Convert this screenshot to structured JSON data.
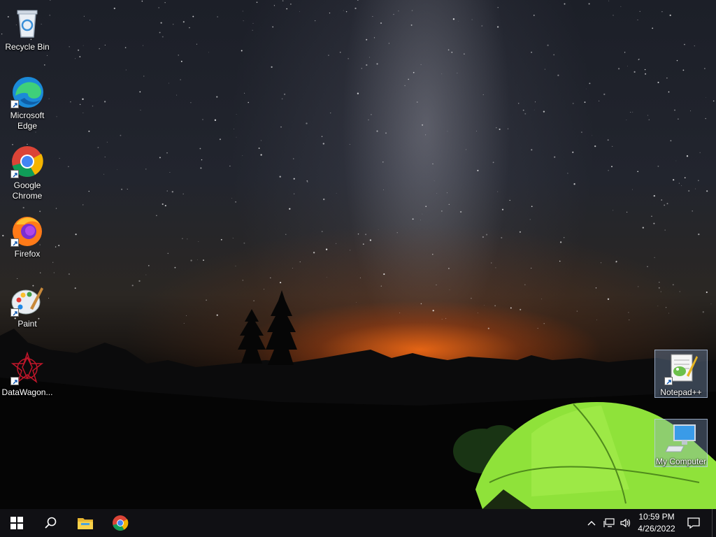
{
  "desktop": {
    "icons": [
      {
        "label": "Recycle Bin",
        "icon": "recycle-bin-icon"
      },
      {
        "label": "Microsoft Edge",
        "icon": "edge-icon"
      },
      {
        "label": "Google Chrome",
        "icon": "chrome-icon"
      },
      {
        "label": "Firefox",
        "icon": "firefox-icon"
      },
      {
        "label": "Paint",
        "icon": "paint-icon"
      },
      {
        "label": "DataWagon...",
        "icon": "datawagon-icon"
      },
      {
        "label": "Notepad++",
        "icon": "notepad-plus-plus-icon",
        "selected": true
      },
      {
        "label": "My Computer",
        "icon": "computer-icon",
        "selected": true
      }
    ]
  },
  "taskbar": {
    "start": {
      "icon": "windows-start-icon"
    },
    "search": {
      "icon": "search-icon"
    },
    "pinned": [
      {
        "icon": "file-explorer-icon"
      },
      {
        "icon": "chrome-icon"
      }
    ],
    "tray": {
      "icons": [
        "chevron-up-icon",
        "network-icon",
        "volume-icon"
      ]
    },
    "clock": {
      "time": "10:59 PM",
      "date": "4/26/2022"
    },
    "notifications": {
      "icon": "action-center-icon"
    }
  },
  "colors": {
    "taskbar_bg": "#101014",
    "tent_green": "#8fe23a",
    "horizon_orange": "#ff6e14",
    "selection": "#8caad2"
  }
}
